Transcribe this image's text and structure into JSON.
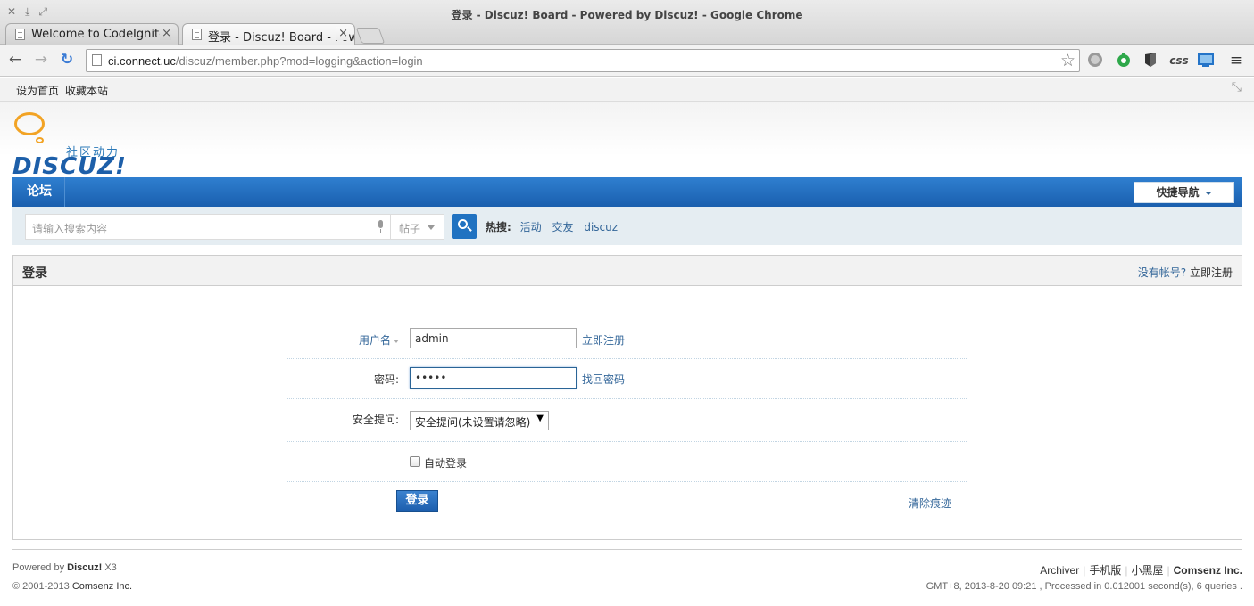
{
  "window": {
    "title": "登录 - Discuz! Board - Powered by Discuz! - Google Chrome",
    "controls": [
      "✕",
      "⤓",
      "⤢"
    ]
  },
  "tabs": [
    {
      "label": "Welcome to CodeIgniter",
      "close": "×",
      "icon": "page-icon"
    },
    {
      "label": "登录 - Discuz! Board - Powered by Discuz!",
      "close": "×",
      "icon": "page-icon"
    }
  ],
  "toolbar": {
    "back": "←",
    "forward": "→",
    "reload": "↻",
    "url_host": "ci.connect.uc",
    "url_path": "/discuz/member.php?mod=logging&action=login",
    "star": "☆",
    "extensions": [
      "globe-icon",
      "green-icon",
      "shield-icon",
      "css-icon",
      "screen-icon"
    ],
    "ext_css_label": "css",
    "menu": "≡"
  },
  "bookmarks": {
    "items": [
      "设为首页",
      "收藏本站"
    ],
    "shrink": "⤡"
  },
  "logo": {
    "slogan": "社区动力",
    "word": "DISCUZ!"
  },
  "nav": {
    "item": "论坛",
    "quick": "快捷导航"
  },
  "search": {
    "placeholder": "请输入搜索内容",
    "type": "帖子",
    "hot_label": "热搜:",
    "hot": [
      "活动",
      "交友",
      "discuz"
    ]
  },
  "login": {
    "title": "登录",
    "no_account": "没有帐号?",
    "register_now": "立即注册",
    "username_label": "用户名",
    "username_value": "admin",
    "register_link": "立即注册",
    "password_label": "密码:",
    "password_value": "•••••",
    "find_password": "找回密码",
    "question_label": "安全提问:",
    "question_value": "安全提问(未设置请忽略)",
    "auto_login": "自动登录",
    "submit": "登录",
    "clear_traces": "清除痕迹"
  },
  "footer": {
    "powered_by": "Powered by",
    "brand": "Discuz!",
    "version": "X3",
    "copyright": "© 2001-2013",
    "company": "Comsenz Inc.",
    "links": [
      "Archiver",
      "手机版",
      "小黑屋",
      "Comsenz Inc."
    ],
    "stats": "GMT+8, 2013-8-20 09:21 , Processed in 0.012001 second(s), 6 queries ."
  }
}
